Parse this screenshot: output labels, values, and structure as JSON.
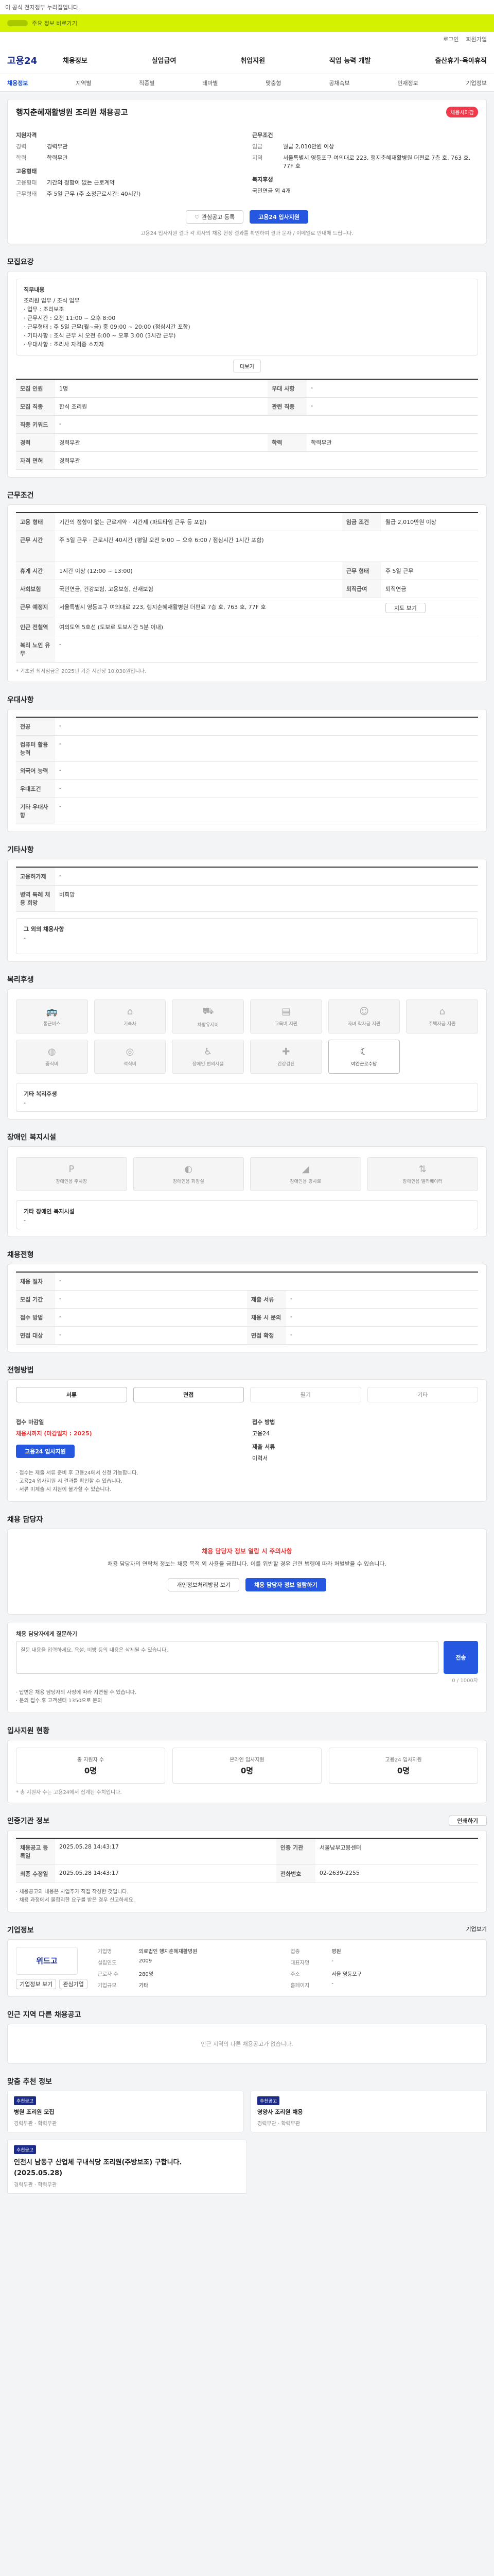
{
  "top": {
    "notice": "이 공식 전자정부 누리집입니다.",
    "green_hint": "주요 정보 바로가기"
  },
  "util": {
    "login": "로그인",
    "join": "회원가입"
  },
  "logo": "고용24",
  "gnb": [
    "채용정보",
    "실업급여",
    "취업지원",
    "직업 능력 개발",
    "출산휴가·육아휴직"
  ],
  "snb": [
    "채용정보",
    "지역별",
    "직종별",
    "테마별",
    "맞춤형",
    "공채속보",
    "인재정보",
    "기업정보"
  ],
  "job": {
    "title": "행지춘혜재활병원 조리원 채용공고",
    "badge": "채용시마감",
    "left_lbl": "지원자격",
    "right_lbl": "근무조건",
    "left": [
      {
        "k": "경력",
        "v": "경력무관"
      },
      {
        "k": "학력",
        "v": "학력무관"
      }
    ],
    "right": [
      {
        "k": "임금",
        "v": "월급 2,010만원 이상"
      },
      {
        "k": "지역",
        "v": "서울특별시 영등포구 여의대로 223, 행지춘혜재활병원 더편료 7층 호, 763 호, 77F 호"
      }
    ],
    "left2_lbl": "고용형태",
    "left2": [
      {
        "k": "고용형태",
        "v": "기간의 정함이 없는 근로계약"
      },
      {
        "k": "근무형태",
        "v": "주 5일 근무 (주 소정근로시간: 40시간)"
      }
    ],
    "right2_lbl": "복지후생",
    "right2": "국민연금 외 4개",
    "btn_scrap": "관심공고 등록",
    "btn_apply": "고용24 입사지원",
    "note": "고용24 입사지원 결과 각 회사의 채용 현장 결과를 확인하여 결과 문자 / 이메일로 안내해 드립니다."
  },
  "recruit": {
    "head": "모집요강",
    "lbl": "직무내용",
    "lines": [
      "조리원 업무 / 조식 업무",
      "· 업무 : 조리보조",
      "· 근무시간 : 오전 11:00 ~ 오후 8:00",
      "· 근무형태 : 주 5일 근무(월~금) 중 09:00 ~ 20:00 (점심시간 포함)",
      "· 기타사항 : 조식 근무 시 오전 6:00 ~ 오후 3:00 (3시간 근무)",
      "· 우대사항 : 조리사 자격증 소지자"
    ],
    "more": "더보기"
  },
  "recruit_tbl": [
    {
      "k1": "모집 인원",
      "v1": "1명",
      "k2": "우대 사항",
      "v2": "-"
    },
    {
      "k1": "모집 직종",
      "v1": "한식 조리원",
      "k2": "관련 직종",
      "v2": "-"
    },
    {
      "k1": "직종 키워드",
      "v1": "-",
      "k2": "",
      "v2": ""
    },
    {
      "k1": "경력",
      "v1": "경력무관",
      "k2": "학력",
      "v2": "학력무관"
    },
    {
      "k1": "자격 면허",
      "v1": "경력무관",
      "k2": "",
      "v2": ""
    }
  ],
  "cond": {
    "head": "근무조건",
    "rows": [
      {
        "k": "고용 형태",
        "v": "기간의 정함이 없는 근로계약 · 시간제 (파트타임 근무 등 포함)",
        "k2": "임금 조건",
        "v2": "월급 2,010만원 이상"
      },
      {
        "k": "근무 시간",
        "v": "주 5일 근무 · 근로시간 40시간 (평일 오전 9:00 ~ 오후 6:00 / 점심시간 1시간 포함)",
        "k2": "",
        "v2": ""
      },
      {
        "k": "휴게 시간",
        "v": "1시간 이상 (12:00 ~ 13:00)",
        "k2": "근무 형태",
        "v2": "주 5일 근무"
      },
      {
        "k": "사회보험",
        "v": "국민연금, 건강보험, 고용보험, 산재보험",
        "k2": "퇴직급여",
        "v2": "퇴직연금"
      },
      {
        "k": "근무 예정지",
        "v": "서울특별시 영등포구 여의대로 223, 행지춘혜재활병원 더편료 7층 호, 763 호, 77F 호",
        "k2": "",
        "v2": ""
      },
      {
        "k": "인근 전철역",
        "v": "여의도역 5호선 (도보로 도보시간 5분 이내)",
        "k2": "",
        "v2": ""
      },
      {
        "k": "복리 노인 유무",
        "v": "-",
        "k2": "",
        "v2": ""
      }
    ],
    "map_btn": "지도 보기",
    "note": "* 기초권 최저임금은 2025년 기준 시간당 10,030원입니다."
  },
  "pref": {
    "head": "우대사항",
    "rows": [
      {
        "k": "전공",
        "v": "-"
      },
      {
        "k": "컴퓨터 활용 능력",
        "v": "-"
      },
      {
        "k": "외국어 능력",
        "v": "-"
      },
      {
        "k": "우대조건",
        "v": "-"
      },
      {
        "k": "기타 우대사항",
        "v": "-"
      }
    ]
  },
  "extra": {
    "head": "기타사항",
    "rows": [
      {
        "k": "고용허가제",
        "v": "-"
      },
      {
        "k": "병역 특례 채용 희망",
        "v": "비희망"
      }
    ],
    "etc_lbl": "그 외의 채용사항",
    "etc_v": "-"
  },
  "welfare": {
    "head": "복리후생",
    "items": [
      "통근버스",
      "기숙사",
      "차량유지비",
      "교육비 지원",
      "자녀 학자금 지원",
      "주택자금 지원",
      "중식비",
      "석식비",
      "장애인 편의시설",
      "건강검진",
      "야간근로수당"
    ],
    "on_label": "야간근로수당",
    "etc_lbl": "기타 복리후생",
    "etc_v": "-"
  },
  "disabled": {
    "head": "장애인 복지시설",
    "items": [
      "장애인용 주차장",
      "장애인용 화장실",
      "장애인용 경사로",
      "장애인용 엘리베이터"
    ],
    "etc_lbl": "기타 장애인 복지시설",
    "etc_v": "-"
  },
  "method": {
    "head": "채용전형",
    "rows": [
      {
        "k": "채용 절차",
        "v": "-"
      },
      {
        "k": "모집 기간",
        "v": "-",
        "k2": "제출 서류",
        "v2": "-"
      },
      {
        "k": "접수 방법",
        "v": "-",
        "k2": "채용 시 문의",
        "v2": "-"
      },
      {
        "k": "면접 대상",
        "v": "-",
        "k2": "면접 확정",
        "v2": "-"
      }
    ]
  },
  "apply": {
    "head": "전형방법",
    "steps": [
      "서류",
      "면접",
      "필기",
      "기타"
    ],
    "period_lbl": "접수 마감일",
    "period_v": "채용시까지 (마감일자 : 2025)",
    "way_lbl": "접수 방법",
    "way_v": "고용24",
    "docs_lbl": "제출 서류",
    "docs_v": "이력서",
    "btn": "고용24 입사지원",
    "notes": [
      "· 접수는 제출 서류 준비 후 고용24에서 신청 가능합니다.",
      "· 고용24 입사지원 시 결과를 확인할 수 있습니다.",
      "· 서류 미제출 시 지원이 불가할 수 있습니다."
    ]
  },
  "contact": {
    "head": "채용 담당자",
    "alert_t": "채용 담당자 정보 열람 시 주의사항",
    "alert_d": "채용 담당자의 연락처 정보는 채용 목적 외 사용을 금합니다. 이를 위반할 경우 관련 법령에 따라 처벌받을 수 있습니다.",
    "btn1": "개인정보처리방침 보기",
    "btn2": "채용 담당자 정보 열람하기"
  },
  "ask": {
    "head": "채용 담당자에게 질문하기",
    "placeholder": "질문 내용을 입력하세요. 욕설, 비방 등의 내용은 삭제될 수 있습니다.",
    "counter": "0 / 1000자",
    "btn": "전송",
    "notes": [
      "· 답변은 채용 담당자의 사정에 따라 지연될 수 있습니다.",
      "· 문의 접수 후 고객센터 1350으로 문의"
    ]
  },
  "status": {
    "head": "입사지원 현황",
    "items": [
      {
        "n": "총 지원자 수",
        "c": "0명"
      },
      {
        "n": "온라인 입사지원",
        "c": "0명"
      },
      {
        "n": "고용24 입사지원",
        "c": "0명"
      }
    ],
    "note": "* 총 지원자 수는 고용24에서 집계된 수치입니다."
  },
  "info": {
    "head": "인증기관 정보",
    "print": "인쇄하기",
    "rows": [
      {
        "k": "채용공고 등록일",
        "v": "2025.05.28 14:43:17",
        "k2": "인증 기관",
        "v2": "서울남부고용센터"
      },
      {
        "k": "최종 수정일",
        "v": "2025.05.28 14:43:17",
        "k2": "전화번호",
        "v2": "02-2639-2255"
      }
    ],
    "notes": [
      "· 채용공고의 내용은 사업주가 직접 작성한 것입니다.",
      "· 채용 과정에서 불합리한 요구를 받은 경우 신고하세요."
    ]
  },
  "company": {
    "head": "기업정보",
    "more": "기업보기",
    "logo": "위드고",
    "btn1": "기업정보 보기",
    "btn2": "관심기업",
    "rows": [
      {
        "k": "기업명",
        "v": "의료법인 행지춘혜재활병원"
      },
      {
        "k": "업종",
        "v": "병원"
      },
      {
        "k": "설립연도",
        "v": "2009"
      },
      {
        "k": "대표자명",
        "v": "-"
      },
      {
        "k": "근로자 수",
        "v": "280명"
      },
      {
        "k": "주소",
        "v": "서울 영등포구"
      },
      {
        "k": "기업규모",
        "v": "기타"
      },
      {
        "k": "홈페이지",
        "v": "-"
      }
    ]
  },
  "nearby": {
    "head": "인근 지역 다른 채용공고",
    "empty": "인근 지역의 다른 채용공고가 없습니다."
  },
  "rec": {
    "head": "맞춤 추천 정보",
    "cards": [
      {
        "tag": "추천공고",
        "t": "병원 조리원 모집",
        "m1": "경력무관",
        "m2": "학력무관"
      },
      {
        "tag": "추천공고",
        "t": "영양사 조리원 채용",
        "m1": "경력무관",
        "m2": "학력무관"
      }
    ],
    "big": {
      "tag": "추천공고",
      "t": "인천시 남동구 산업체 구내식당 조리원(주방보조) 구합니다.",
      "d": "(2025.05.28)",
      "m1": "경력무관",
      "m2": "학력무관"
    }
  }
}
